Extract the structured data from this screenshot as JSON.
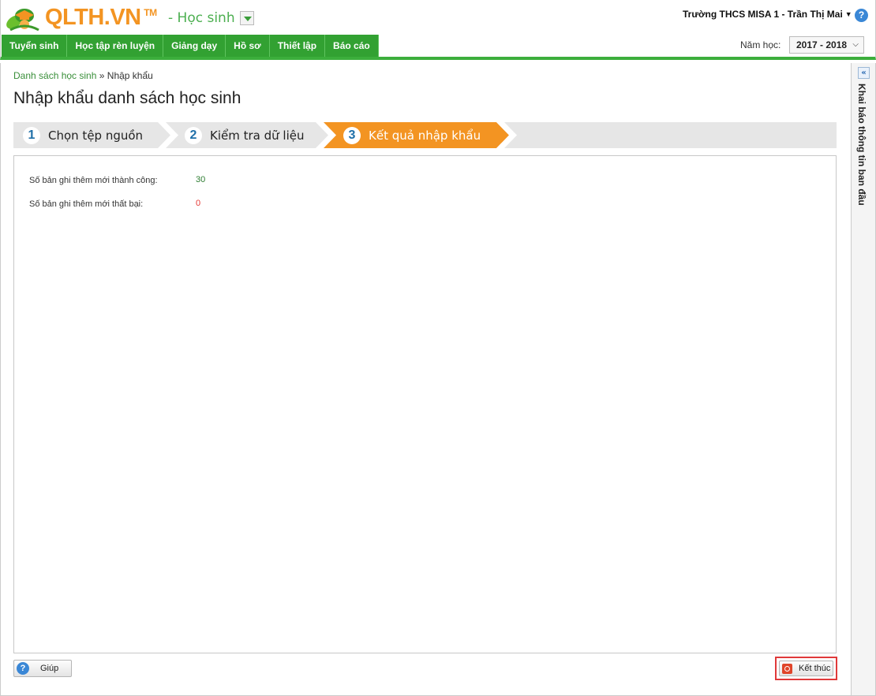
{
  "header": {
    "logo_text": "QLTH.VN",
    "logo_tm": "TM",
    "module_label": "- Học sinh",
    "user_label": "Trường THCS MISA 1 - Trần Thị Mai",
    "help_glyph": "?"
  },
  "nav": {
    "tabs": [
      "Tuyển sinh",
      "Học tập rèn luyện",
      "Giảng dạy",
      "Hồ sơ",
      "Thiết lập",
      "Báo cáo"
    ],
    "year_label": "Năm học:",
    "year_value": "2017 - 2018"
  },
  "breadcrumb": {
    "link": "Danh sách học sinh",
    "separator": "»",
    "current": "Nhập khẩu"
  },
  "page_title": "Nhập khẩu danh sách học sinh",
  "steps": [
    {
      "num": "1",
      "label": "Chọn tệp nguồn",
      "active": false
    },
    {
      "num": "2",
      "label": "Kiểm tra dữ liệu",
      "active": false
    },
    {
      "num": "3",
      "label": "Kết quả nhập khẩu",
      "active": true
    }
  ],
  "results": [
    {
      "label": "Số bản ghi thêm mới thành công:",
      "value": "30",
      "color": "#2e7d32"
    },
    {
      "label": "Số bản ghi thêm mới thất bại:",
      "value": "0",
      "color": "#e53935"
    }
  ],
  "buttons": {
    "help": "Giúp",
    "finish": "Kết thúc"
  },
  "side_panel": {
    "toggle_glyph": "«",
    "label": "Khai báo thông tin ban đầu"
  },
  "colors": {
    "brand_orange": "#f39422",
    "nav_green": "#32a132",
    "active_step": "#f39422"
  }
}
